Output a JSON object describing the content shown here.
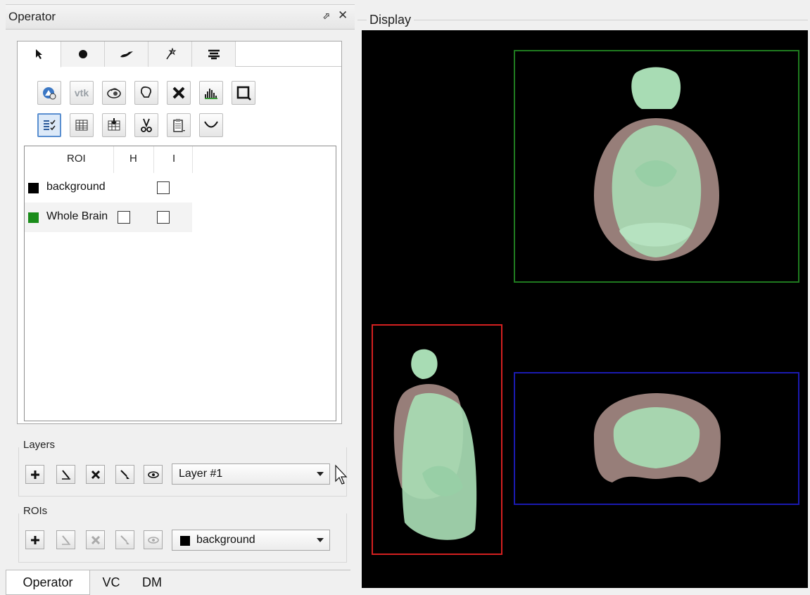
{
  "operator_panel": {
    "title": "Operator",
    "float_icon": "float-icon",
    "close_icon": "close-icon",
    "tool_tabs": [
      {
        "glyph": "➤",
        "icon": "pointer-icon"
      },
      {
        "glyph": "●",
        "icon": "dot-icon"
      },
      {
        "glyph": "≈",
        "icon": "brush-icon"
      },
      {
        "glyph": "⤯",
        "icon": "magic-wand-icon"
      },
      {
        "glyph": "☰",
        "icon": "layers-stack-icon"
      }
    ],
    "toolbar_row1": [
      {
        "icon": "refresh-3d-icon"
      },
      {
        "icon": "vtk-icon",
        "label": "vtk"
      },
      {
        "icon": "render-icon"
      },
      {
        "icon": "lasso-icon"
      },
      {
        "icon": "delete-icon"
      },
      {
        "icon": "histogram-icon"
      },
      {
        "icon": "crop-icon"
      }
    ],
    "toolbar_row2": [
      {
        "icon": "list-check-icon"
      },
      {
        "icon": "table-icon"
      },
      {
        "icon": "import-icon"
      },
      {
        "icon": "cut-icon"
      },
      {
        "icon": "paste-icon"
      },
      {
        "icon": "curve-icon"
      }
    ],
    "roi_table": {
      "headers": [
        "ROI",
        "H",
        "I"
      ],
      "rows": [
        {
          "name": "background",
          "color": "#000000",
          "h_checkbox": false,
          "i_checked": false
        },
        {
          "name": "Whole Brain",
          "color": "#1a8c1a",
          "h_checkbox": true,
          "h_checked": false,
          "i_checked": false
        }
      ]
    },
    "layers": {
      "label": "Layers",
      "selected": "Layer #1"
    },
    "rois": {
      "label": "ROIs",
      "selected": "background",
      "selected_color": "#000000"
    },
    "bottom_tabs": [
      "Operator",
      "VC",
      "DM"
    ]
  },
  "display_panel": {
    "title": "Display",
    "views": [
      {
        "name": "axial",
        "border_color": "#1f7a1f"
      },
      {
        "name": "sagittal",
        "border_color": "#d42020"
      },
      {
        "name": "coronal",
        "border_color": "#1a1ab0"
      }
    ]
  }
}
